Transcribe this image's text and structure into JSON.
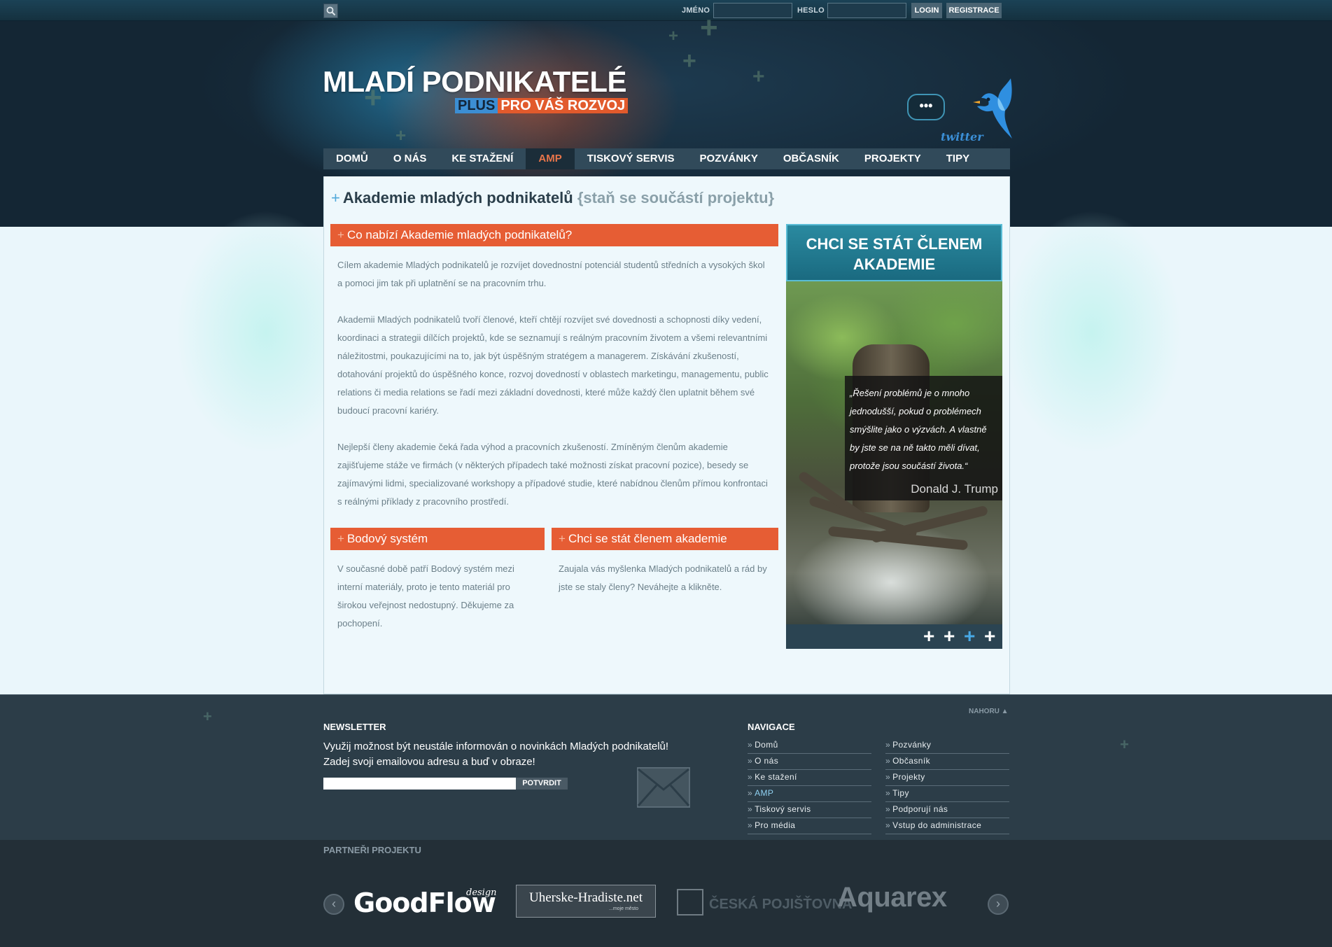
{
  "topbar": {
    "username_label": "JMÉNO",
    "password_label": "HESLO",
    "login_button": "LOGIN",
    "register_button": "REGISTRACE"
  },
  "logo": {
    "title": "MLADÍ PODNIKATELÉ",
    "subtitle_plus": "PLUS",
    "subtitle_rest": "PRO VÁŠ ROZVOJ"
  },
  "twitter": {
    "bubble": "•••",
    "label": "twitter"
  },
  "nav": {
    "items": [
      "DOMŮ",
      "O NÁS",
      "KE STAŽENÍ",
      "AMP",
      "TISKOVÝ SERVIS",
      "POZVÁNKY",
      "OBČASNÍK",
      "PROJEKTY",
      "TIPY"
    ],
    "active": "AMP"
  },
  "page": {
    "title": "Akademie mladých podnikatelů",
    "title_sub": "{staň se součástí projektu}"
  },
  "sections": {
    "offer": {
      "heading": "Co nabízí Akademie mladých podnikatelů?",
      "p1": "Cílem akademie Mladých podnikatelů je rozvíjet dovednostní potenciál studentů středních a vysokých škol a pomoci jim tak při uplatnění se na pracovním trhu.",
      "p2": "Akademii Mladých podnikatelů tvoří členové, kteří chtějí rozvíjet své dovednosti a schopnosti díky vedení, koordinaci a strategii dílčích projektů, kde se seznamují s reálným pracovním životem a všemi relevantními náležitostmi, poukazujícími na to, jak být úspěšným stratégem a managerem. Získávání zkušeností, dotahování projektů do úspěšného konce, rozvoj dovedností v oblastech marketingu, managementu, public relations či media relations se řadí mezi základní dovednosti, které může každý člen uplatnit během své budoucí pracovní kariéry.",
      "p3": "Nejlepší členy akademie čeká řada výhod a pracovních zkušeností. Zmíněným členům akademie zajišťujeme stáže ve firmách (v některých případech také možnosti získat pracovní pozice), besedy se zajímavými lidmi, specializované workshopy a případové studie, které nabídnou členům přímou konfrontaci s reálnými příklady z pracovního prostředí."
    },
    "points": {
      "heading": "Bodový systém",
      "text": "V současné době patří Bodový systém mezi interní materiály, proto je tento materiál pro širokou veřejnost nedostupný. Děkujeme za pochopení."
    },
    "become_member": {
      "heading": "Chci se stát členem akademie",
      "text": "Zaujala vás myšlenka Mladých podnikatelů a rád by jste se staly členy? Neváhejte a klikněte."
    }
  },
  "join_panel": {
    "heading": "CHCI SE STÁT ČLENEM AKADEMIE",
    "quote": "„Řešení problémů je o mnoho jednodušší, pokud o problémech smýšlite jako o výzvách. A vlastně by jste se na ně takto měli dívat, protože jsou součástí života.“",
    "author": "Donald J. Trump",
    "slides": [
      "+",
      "+",
      "+",
      "+"
    ],
    "active_slide": 3
  },
  "footer": {
    "back_to_top": "NAHORU ▲",
    "newsletter": {
      "heading": "NEWSLETTER",
      "text": "Využij možnost být neustále informován o novinkách Mladých podnikatelů! Zadej svoji emailovou adresu a buď v obraze!",
      "submit": "POTVRDIT"
    },
    "navigation": {
      "heading": "NAVIGACE",
      "col1": [
        "Domů",
        "O nás",
        "Ke stažení",
        "AMP",
        "Tiskový servis",
        "Pro média"
      ],
      "col2": [
        "Pozvánky",
        "Občasník",
        "Projekty",
        "Tipy",
        "Podporují nás",
        "Vstup do administrace"
      ],
      "active": "AMP"
    }
  },
  "partners": {
    "heading": "PARTNEŘI PROJEKTU",
    "logos": {
      "goodflow": "GoodFlow",
      "goodflow_suffix": "design",
      "uh": "Uherske-Hradiste.net",
      "uh_sub": "...moje město",
      "cp": "ČESKÁ POJIŠŤOVNA",
      "aquarex": "Aquarex"
    }
  },
  "colors": {
    "accent_orange": "#e65d34",
    "nav_bg": "#314a5a",
    "header_bg": "#142634",
    "footer_bg": "#2c3d48",
    "content_bg": "#eef8fc"
  }
}
